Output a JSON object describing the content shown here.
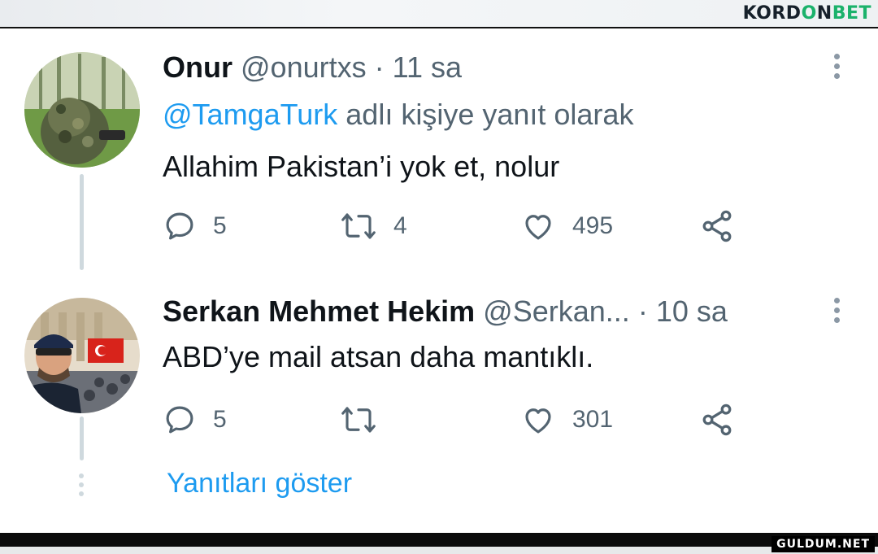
{
  "brand": {
    "part1": "KORD",
    "part2": "O",
    "part3": "N",
    "part4": "BET"
  },
  "tweet1": {
    "display_name": "Onur",
    "handle": "@onurtxs",
    "separator": "·",
    "time": "11 sa",
    "reply_to_handle": "@TamgaTurk",
    "reply_to_suffix": "adlı kişiye yanıt olarak",
    "text": "Allahim Pakistan’i yok et, nolur",
    "replies": "5",
    "retweets": "4",
    "likes": "495"
  },
  "tweet2": {
    "display_name": "Serkan Mehmet Hekim",
    "handle": "@Serkan...",
    "separator": "·",
    "time": "10 sa",
    "text": "ABD’ye mail atsan daha mantıklı.",
    "replies": "5",
    "retweets": "",
    "likes": "301"
  },
  "show_replies": "Yanıtları göster",
  "watermark": "GULDUM.NET",
  "icons": {
    "reply": "reply-icon",
    "retweet": "retweet-icon",
    "like": "heart-icon",
    "share": "share-icon",
    "more": "more-vertical-icon"
  },
  "colors": {
    "link": "#1d9bf0",
    "muted": "#536471",
    "text": "#0f1419",
    "brand_accent": "#1bb26b"
  }
}
